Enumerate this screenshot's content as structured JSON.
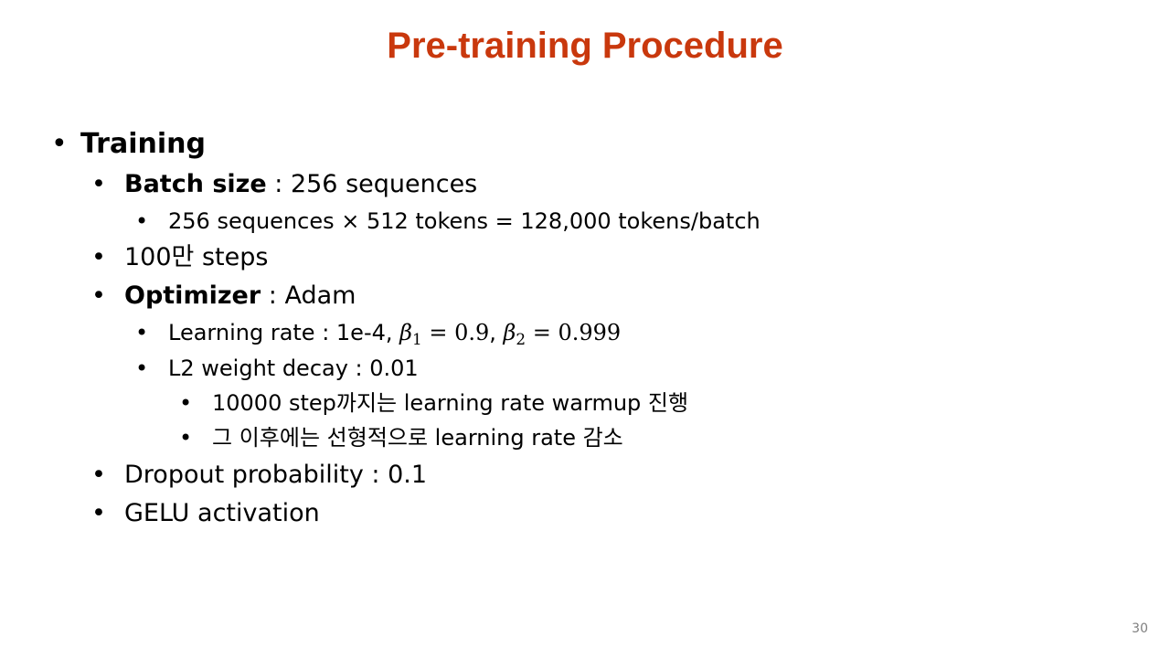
{
  "slide": {
    "title": "Pre-training Procedure",
    "page_number": "30",
    "accent_color": "#c9380d",
    "bullet_char": "•",
    "training": {
      "heading": "Training",
      "batch": {
        "label": "Batch size",
        "value": " : 256 sequences",
        "detail": "256 sequences × 512 tokens = 128,000 tokens/batch"
      },
      "steps": "100만 steps",
      "optimizer": {
        "label": "Optimizer",
        "value": " : Adam",
        "lr": {
          "prefix": "Learning rate : 1e-4, ",
          "beta1_symbol": "β",
          "beta1_sub": "1",
          "beta1_value": " = 0.9",
          "separator": ", ",
          "beta2_symbol": "β",
          "beta2_sub": "2",
          "beta2_value": " = 0.999"
        },
        "decay": "L2 weight decay : 0.01",
        "warmup": "10000 step까지는 learning rate warmup 진행",
        "linear": "그 이후에는 선형적으로 learning rate 감소"
      },
      "dropout": "Dropout probability : 0.1",
      "activation": "GELU activation"
    }
  }
}
